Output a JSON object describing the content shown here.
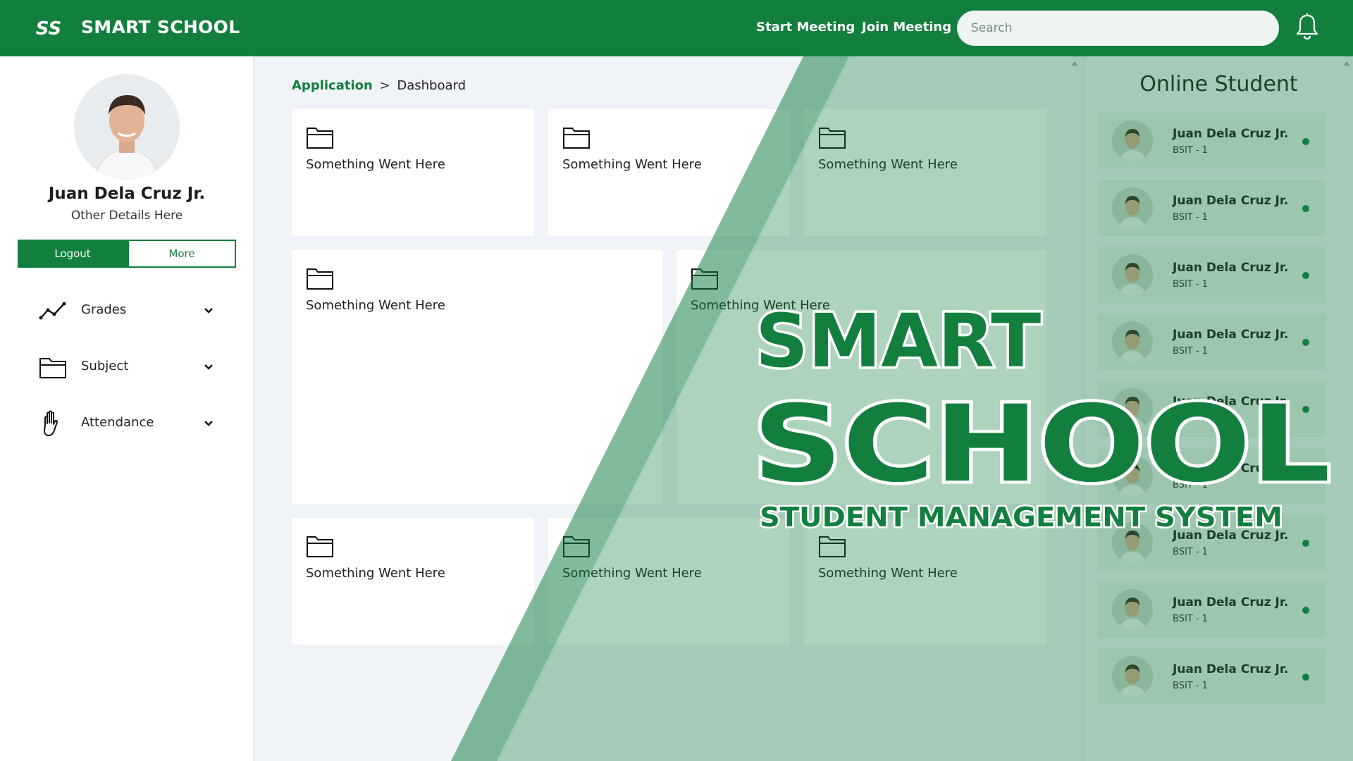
{
  "header": {
    "app_title": "SMART SCHOOL",
    "logo_mark": "SS",
    "start_meeting": "Start Meeting",
    "join_meeting": "Join Meeting",
    "search_placeholder": "Search",
    "bell_icon": "bell-icon",
    "brand_color": "#137f3f"
  },
  "profile": {
    "name": "Juan Dela Cruz Jr.",
    "details": "Other Details Here",
    "logout_label": "Logout",
    "more_label": "More"
  },
  "sidebar": {
    "items": [
      {
        "label": "Grades",
        "icon": "line-chart-icon"
      },
      {
        "label": "Subject",
        "icon": "folder-icon"
      },
      {
        "label": "Attendance",
        "icon": "hand-icon"
      }
    ]
  },
  "breadcrumb": {
    "root": "Application",
    "separator": ">",
    "current": "Dashboard"
  },
  "cards": [
    {
      "text": "Something Went Here"
    },
    {
      "text": "Something Went Here"
    },
    {
      "text": "Something Went Here"
    },
    {
      "text": "Something Went Here"
    },
    {
      "text": "Something Went Here"
    },
    {
      "text": "Something Went Here"
    },
    {
      "text": "Something Went Here"
    },
    {
      "text": "Something Went Here"
    }
  ],
  "online": {
    "title": "Online Student",
    "students": [
      {
        "name": "Juan Dela Cruz Jr.",
        "course": "BSIT - 1"
      },
      {
        "name": "Juan Dela Cruz Jr.",
        "course": "BSIT - 1"
      },
      {
        "name": "Juan Dela Cruz Jr.",
        "course": "BSIT - 1"
      },
      {
        "name": "Juan Dela Cruz Jr.",
        "course": "BSIT - 1"
      },
      {
        "name": "Juan Dela Cruz Jr.",
        "course": "BSIT - 1"
      },
      {
        "name": "Juan Dela Cruz Jr.",
        "course": "BSIT - 1"
      },
      {
        "name": "Juan Dela Cruz Jr.",
        "course": "BSIT - 1"
      },
      {
        "name": "Juan Dela Cruz Jr.",
        "course": "BSIT - 1"
      },
      {
        "name": "Juan Dela Cruz Jr.",
        "course": "BSIT - 1"
      }
    ]
  },
  "branding": {
    "line1": "SMART",
    "line2": "SCHOOL",
    "line3": "STUDENT MANAGEMENT SYSTEM"
  }
}
